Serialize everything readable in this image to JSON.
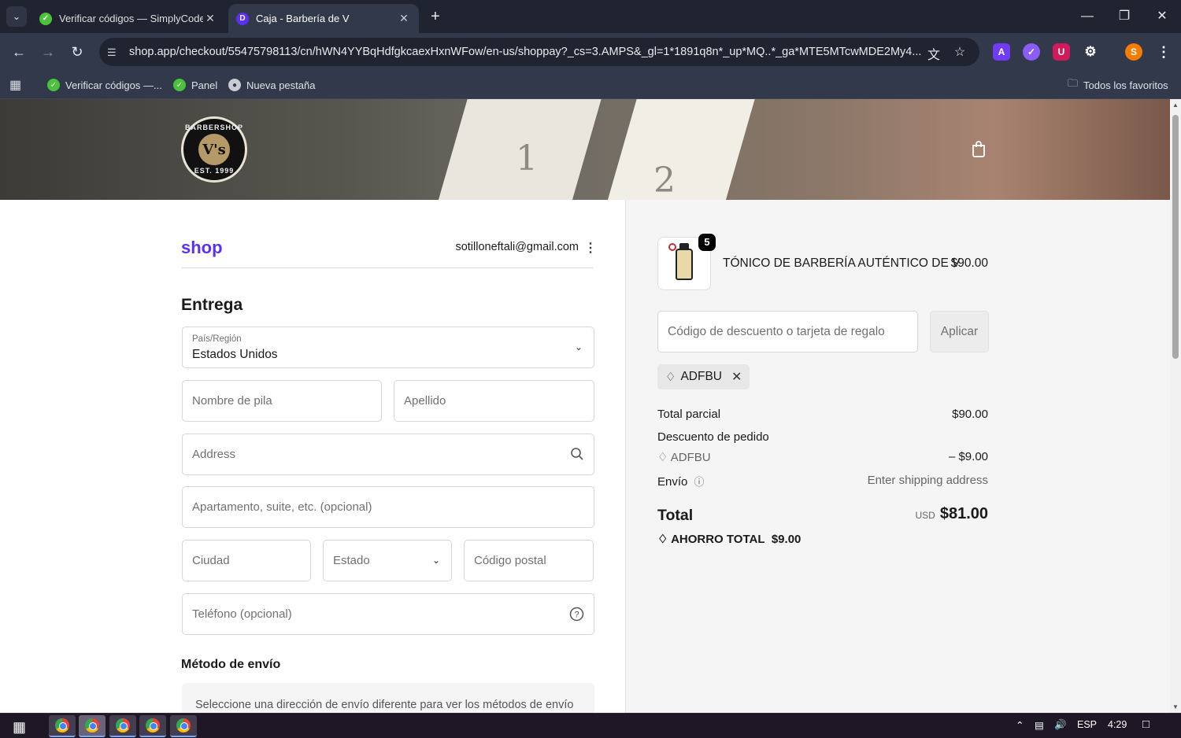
{
  "browser": {
    "tabs": [
      {
        "title": "Verificar códigos — SimplyCodes",
        "active": false
      },
      {
        "title": "Caja - Barbería de V",
        "active": true
      }
    ],
    "new_tab": "+",
    "url": "shop.app/checkout/55475798113/cn/hWN4YYBqHdfgkcaexHxnWFow/en-us/shoppay?_cs=3.AMPS&_gl=1*1891q8n*_up*MQ..*_ga*MTE5MTcwMDE2My4...",
    "profile_initial": "S",
    "extension_initial": "A",
    "bookmarks": [
      {
        "label": "Verificar códigos —..."
      },
      {
        "label": "Panel"
      },
      {
        "label": "Nueva pestaña"
      }
    ],
    "all_bookmarks": "Todos los favoritos"
  },
  "header": {
    "logo_top": "BARBERSHOP",
    "logo_center": "V's",
    "logo_bottom": "EST. 1999"
  },
  "checkout": {
    "shop_brand": "shop",
    "email": "sotilloneftali@gmail.com",
    "section_title": "Entrega",
    "country_label": "País/Región",
    "country_value": "Estados Unidos",
    "first_name_placeholder": "Nombre de pila",
    "last_name_placeholder": "Apellido",
    "address_placeholder": "Address",
    "apartment_placeholder": "Apartamento, suite, etc. (opcional)",
    "city_placeholder": "Ciudad",
    "state_placeholder": "Estado",
    "zip_placeholder": "Código postal",
    "phone_placeholder": "Teléfono (opcional)",
    "shipping_method_title": "Método de envío",
    "shipping_method_note": "Seleccione una dirección de envío diferente para ver los métodos de envío"
  },
  "summary": {
    "product": {
      "name": "TÓNICO DE BARBERÍA AUTÉNTICO DE V",
      "price": "$90.00",
      "quantity": "5"
    },
    "discount_placeholder": "Código de descuento o tarjeta de regalo",
    "apply_label": "Aplicar",
    "applied_code": "ADFBU",
    "subtotal_label": "Total parcial",
    "subtotal_value": "$90.00",
    "order_discount_label": "Descuento de pedido",
    "order_discount_code": "ADFBU",
    "order_discount_value": "– $9.00",
    "shipping_label": "Envío",
    "shipping_value": "Enter shipping address",
    "total_label": "Total",
    "total_currency": "USD",
    "total_value": "$81.00",
    "savings_label": "AHORRO TOTAL",
    "savings_value": "$9.00"
  },
  "taskbar": {
    "language": "ESP",
    "time": "4:29"
  }
}
